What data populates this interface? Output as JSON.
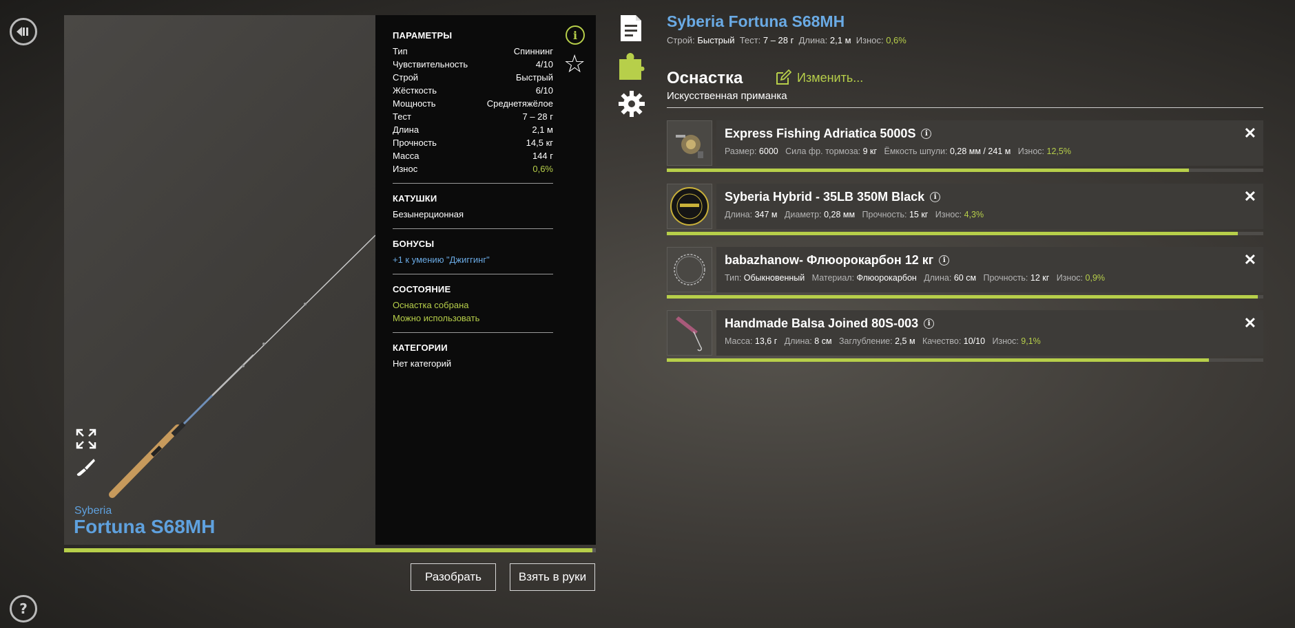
{
  "rod": {
    "brand": "Syberia",
    "name": "Fortuna S68MH",
    "wear_fraction": 0.994
  },
  "params": {
    "title": "ПАРАМЕТРЫ",
    "rows": [
      {
        "k": "Тип",
        "v": "Спиннинг"
      },
      {
        "k": "Чувствительность",
        "v": "4/10"
      },
      {
        "k": "Строй",
        "v": "Быстрый"
      },
      {
        "k": "Жёсткость",
        "v": "6/10"
      },
      {
        "k": "Мощность",
        "v": "Среднетяжёлое"
      },
      {
        "k": "Тест",
        "v": "7 – 28 г"
      },
      {
        "k": "Длина",
        "v": "2,1 м"
      },
      {
        "k": "Прочность",
        "v": "14,5 кг"
      },
      {
        "k": "Масса",
        "v": "144 г"
      },
      {
        "k": "Износ",
        "v": "0,6%"
      }
    ],
    "reels_title": "КАТУШКИ",
    "reels_value": "Безынерционная",
    "bonus_title": "БОНУСЫ",
    "bonus_value": "+1 к умению \"Джиггинг\"",
    "state_title": "СОСТОЯНИЕ",
    "state_1": "Оснастка собрана",
    "state_2": "Можно использовать",
    "cat_title": "КАТЕГОРИИ",
    "cat_value": "Нет категорий"
  },
  "buttons": {
    "disassemble": "Разобрать",
    "take": "Взять в руки"
  },
  "header": {
    "title": "Syberia Fortuna S68MH",
    "k1": "Строй:",
    "v1": "Быстрый",
    "k2": "Тест:",
    "v2": "7 – 28 г",
    "k3": "Длина:",
    "v3": "2,1 м",
    "k4": "Износ:",
    "v4": "0,6%"
  },
  "tackle": {
    "title": "Оснастка",
    "edit": "Изменить...",
    "lure_type": "Искусственная приманка"
  },
  "items": [
    {
      "name": "Express Fishing Adriatica 5000S",
      "props": [
        {
          "k": "Размер:",
          "v": "6000"
        },
        {
          "k": "Сила фр. тормоза:",
          "v": "9 кг"
        },
        {
          "k": "Ёмкость шпули:",
          "v": "0,28 мм / 241 м"
        },
        {
          "k": "Износ:",
          "v": "12,5%",
          "green": true
        }
      ],
      "condition": 0.875
    },
    {
      "name": "Syberia Hybrid - 35LB 350M Black",
      "props": [
        {
          "k": "Длина:",
          "v": "347 м"
        },
        {
          "k": "Диаметр:",
          "v": "0,28 мм"
        },
        {
          "k": "Прочность:",
          "v": "15 кг"
        },
        {
          "k": "Износ:",
          "v": "4,3%",
          "green": true
        }
      ],
      "condition": 0.957
    },
    {
      "name": "babazhanow- Флюорокарбон 12 кг",
      "props": [
        {
          "k": "Тип:",
          "v": "Обыкновенный"
        },
        {
          "k": "Материал:",
          "v": "Флюорокарбон"
        },
        {
          "k": "Длина:",
          "v": "60 см"
        },
        {
          "k": "Прочность:",
          "v": "12 кг"
        },
        {
          "k": "Износ:",
          "v": "0,9%",
          "green": true
        }
      ],
      "condition": 0.991
    },
    {
      "name": "Handmade Balsa Joined 80S-003",
      "props": [
        {
          "k": "Масса:",
          "v": "13,6 г"
        },
        {
          "k": "Длина:",
          "v": "8 см"
        },
        {
          "k": "Заглубление:",
          "v": "2,5 м"
        },
        {
          "k": "Качество:",
          "v": "10/10"
        },
        {
          "k": "Износ:",
          "v": "9,1%",
          "green": true
        }
      ],
      "condition": 0.909
    }
  ],
  "icons": {
    "back": "back-icon",
    "help": "help-icon",
    "info": "info-icon",
    "star": "star-icon",
    "expand": "expand-icon",
    "paint": "paint-brush-icon",
    "doc": "document-icon",
    "puzzle": "puzzle-icon",
    "gear": "gear-icon",
    "close": "close-icon"
  },
  "colors": {
    "accent_green": "#b7cf4a",
    "accent_blue": "#6aaae4"
  }
}
